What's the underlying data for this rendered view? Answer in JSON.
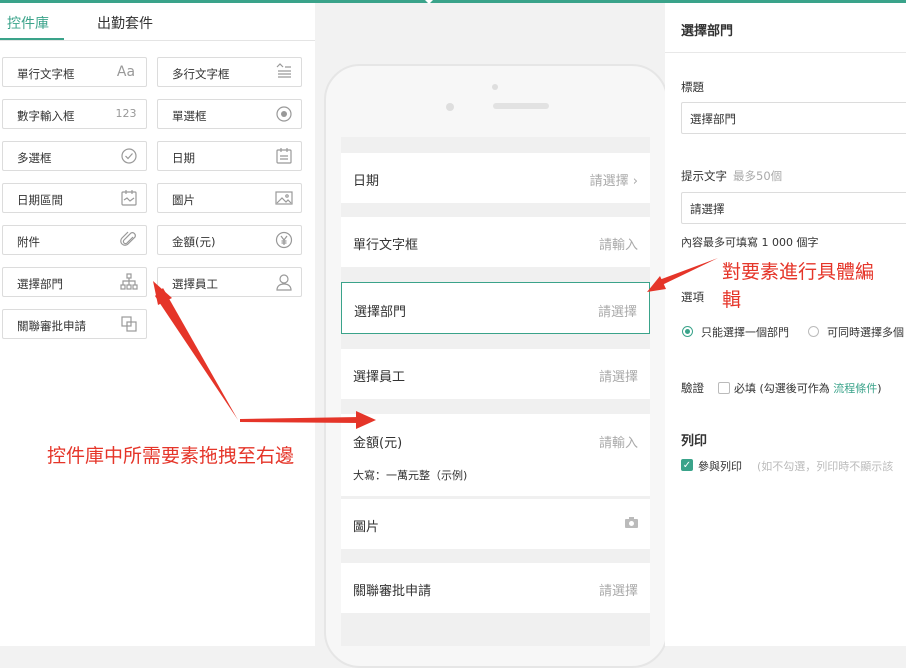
{
  "colors": {
    "accent": "#3aa38a",
    "annotation": "#e53529"
  },
  "left": {
    "tabs": [
      {
        "label": "控件庫",
        "active": true
      },
      {
        "label": "出勤套件",
        "active": false
      }
    ],
    "widgets": [
      {
        "label": "單行文字框",
        "icon": "text-aa-icon",
        "glyph": "Aa"
      },
      {
        "label": "多行文字框",
        "icon": "multiline-text-icon",
        "glyph": ""
      },
      {
        "label": "數字輸入框",
        "icon": "number-icon",
        "glyph": "123"
      },
      {
        "label": "單選框",
        "icon": "radio-icon",
        "glyph": ""
      },
      {
        "label": "多選框",
        "icon": "checkbox-icon",
        "glyph": ""
      },
      {
        "label": "日期",
        "icon": "calendar-icon",
        "glyph": ""
      },
      {
        "label": "日期區間",
        "icon": "date-range-icon",
        "glyph": ""
      },
      {
        "label": "圖片",
        "icon": "image-icon",
        "glyph": ""
      },
      {
        "label": "附件",
        "icon": "paperclip-icon",
        "glyph": ""
      },
      {
        "label": "金額(元)",
        "icon": "yen-icon",
        "glyph": "¥"
      },
      {
        "label": "選擇部門",
        "icon": "org-chart-icon",
        "glyph": ""
      },
      {
        "label": "選擇員工",
        "icon": "person-icon",
        "glyph": ""
      },
      {
        "label": "關聯審批申請",
        "icon": "link-approval-icon",
        "glyph": ""
      }
    ]
  },
  "form": {
    "fields": [
      {
        "label": "日期",
        "value": "請選擇 ›"
      },
      {
        "label": "單行文字框",
        "value": "請輸入"
      },
      {
        "label": "選擇部門",
        "value": "請選擇"
      },
      {
        "label": "選擇員工",
        "value": "請選擇"
      },
      {
        "label": "金額(元)",
        "value": "請輸入",
        "sub": "大寫：一萬元整（示例)"
      },
      {
        "label": "圖片",
        "value": ""
      },
      {
        "label": "關聯審批申請",
        "value": "請選擇"
      }
    ]
  },
  "right": {
    "title": "選擇部門",
    "title_label": "標題",
    "title_value": "選擇部門",
    "hint_label": "提示文字",
    "hint_max": "最多50個",
    "hint_value": "請選擇",
    "hint_note": "內容最多可填寫 1 000 個字",
    "options_label": "選項",
    "option1": "只能選擇一個部門",
    "option2": "可同時選擇多個",
    "validate_label": "驗證",
    "required_text": "必填 (勾選後可作為",
    "flow_link": "流程條件",
    "required_close": ")",
    "print_heading": "列印",
    "print_check": "參與列印",
    "print_note": "(如不勾選，列印時不顯示該"
  },
  "annotations": {
    "drag_note": "控件庫中所需要素拖拽至右邊",
    "edit_note_line1": "對要素進行具體編",
    "edit_note_line2": "輯"
  }
}
